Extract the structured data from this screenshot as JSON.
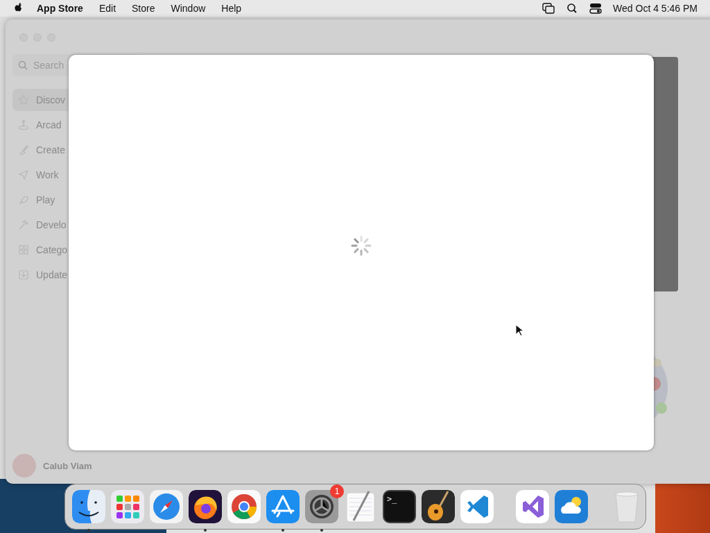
{
  "menu_bar": {
    "app_name": "App Store",
    "menus": [
      "Edit",
      "Store",
      "Window",
      "Help"
    ],
    "clock": "Wed Oct 4  5:46 PM"
  },
  "window": {
    "search": {
      "placeholder": "Search"
    },
    "sidebar": {
      "items": [
        {
          "label": "Discov",
          "selected": true
        },
        {
          "label": "Arcad",
          "selected": false
        },
        {
          "label": "Create",
          "selected": false
        },
        {
          "label": "Work",
          "selected": false
        },
        {
          "label": "Play",
          "selected": false
        },
        {
          "label": "Develo",
          "selected": false
        },
        {
          "label": "Catego",
          "selected": false
        },
        {
          "label": "Update",
          "selected": false
        }
      ]
    },
    "account": {
      "name": "Calub Viam"
    }
  },
  "sheet": {
    "loading": true
  },
  "dock": {
    "items": [
      {
        "kind": "finder",
        "running": true
      },
      {
        "kind": "launchpad",
        "running": false
      },
      {
        "kind": "safari",
        "running": false
      },
      {
        "kind": "firefox",
        "running": true
      },
      {
        "kind": "chrome",
        "running": false
      },
      {
        "kind": "appstore",
        "running": true
      },
      {
        "kind": "settings",
        "running": true,
        "badge": "1"
      },
      {
        "kind": "textedit",
        "running": false
      },
      {
        "kind": "terminal",
        "running": false,
        "glyph": ">_"
      },
      {
        "kind": "garageband",
        "running": false
      },
      {
        "kind": "vscode",
        "running": false
      },
      {
        "kind": "separator"
      },
      {
        "kind": "visualstudio",
        "running": false
      },
      {
        "kind": "weather",
        "running": false
      },
      {
        "kind": "separator"
      },
      {
        "kind": "trash",
        "running": false
      }
    ]
  }
}
